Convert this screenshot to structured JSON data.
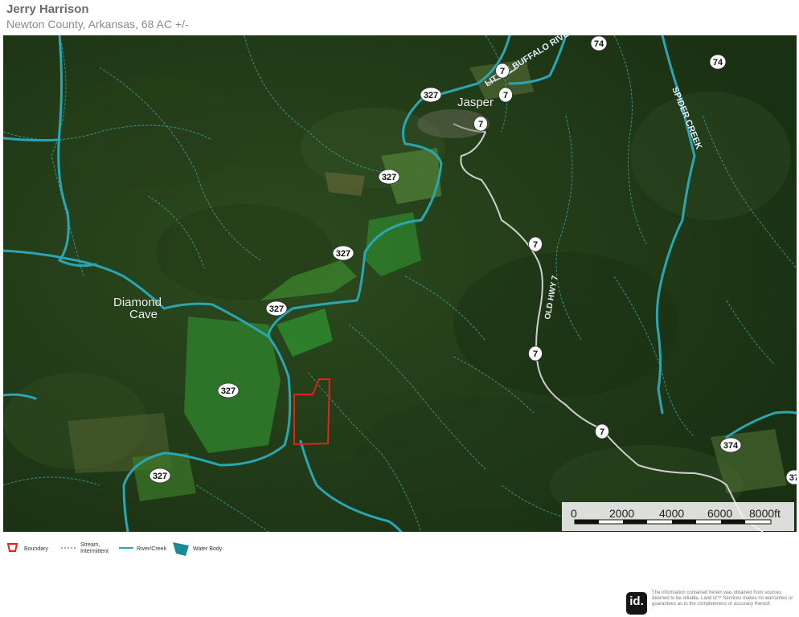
{
  "header": {
    "title": "Jerry Harrison",
    "subtitle": "Newton County, Arkansas, 68 AC +/-"
  },
  "map": {
    "colors": {
      "forest_dark": "#1f3a17",
      "forest_mid": "#2e4d20",
      "field_green": "#2f7a2a",
      "river": "#2aa6b2",
      "stream": "#3fb0b8",
      "road": "#c9c9c9",
      "boundary": "#e0241b",
      "shield_fill": "#ffffff",
      "shield_text": "#111111"
    },
    "places": [
      {
        "label": "Diamond"
      },
      {
        "label": "Cave"
      },
      {
        "label": "Jasper"
      }
    ],
    "water_labels": [
      {
        "label": "LITTLE BUFFALO RIVER"
      },
      {
        "label": "SPIDER CREEK"
      }
    ],
    "road_labels": [
      {
        "label": "OLD HWY 7"
      }
    ],
    "shields": [
      {
        "label": "327"
      },
      {
        "label": "327"
      },
      {
        "label": "327"
      },
      {
        "label": "327"
      },
      {
        "label": "327"
      },
      {
        "label": "327"
      },
      {
        "label": "7"
      },
      {
        "label": "7"
      },
      {
        "label": "7"
      },
      {
        "label": "7"
      },
      {
        "label": "7"
      },
      {
        "label": "7"
      },
      {
        "label": "74"
      },
      {
        "label": "74"
      },
      {
        "label": "374"
      },
      {
        "label": "37"
      }
    ]
  },
  "scale": {
    "ticks": [
      "0",
      "2000",
      "4000",
      "6000",
      "8000ft"
    ]
  },
  "legend": {
    "boundary": "Boundary",
    "stream_line1": "Stream,",
    "stream_line2": "Intermittent",
    "river": "River/Creek",
    "water_body": "Water Body"
  },
  "footer": {
    "logo_text": "id.",
    "disclaimer": "The information contained herein was obtained from sources deemed to be reliable. Land id™ Services makes no warranties or guarantees as to the completeness or accuracy thereof."
  }
}
